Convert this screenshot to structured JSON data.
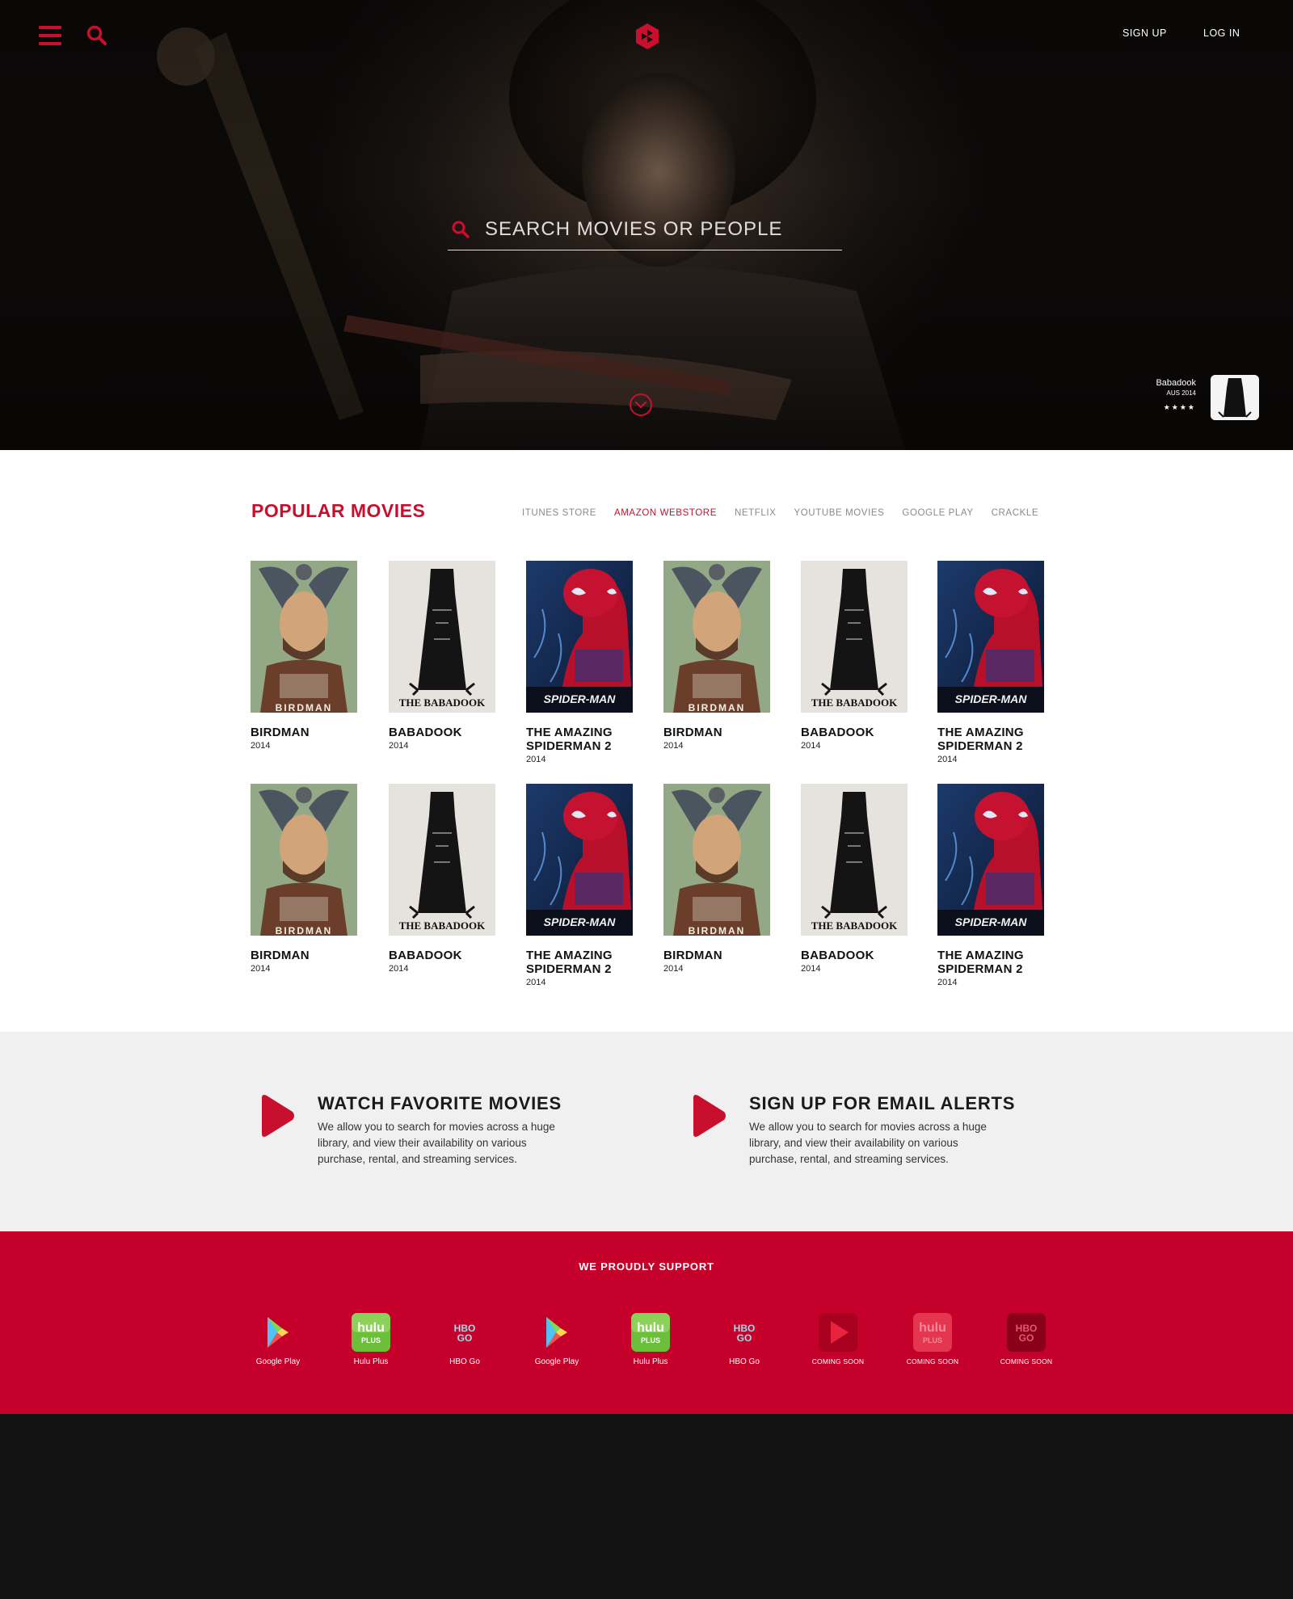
{
  "header": {
    "signup_label": "SIGN UP",
    "login_label": "LOG IN"
  },
  "hero": {
    "search_placeholder": "SEARCH MOVIES OR PEOPLE",
    "featured": {
      "title": "Babadook",
      "subtitle": "AUS 2014",
      "stars": "★★★★"
    }
  },
  "popular": {
    "title": "POPULAR MOVIES",
    "tabs": [
      {
        "label": "ITUNES STORE",
        "active": false
      },
      {
        "label": "AMAZON WEBSTORE",
        "active": true
      },
      {
        "label": "NETFLIX",
        "active": false
      },
      {
        "label": "YOUTUBE MOVIES",
        "active": false
      },
      {
        "label": "GOOGLE PLAY",
        "active": false
      },
      {
        "label": "CRACKLE",
        "active": false
      }
    ],
    "movies": [
      {
        "title": "BIRDMAN",
        "year": "2014",
        "poster": "birdman",
        "poster_text": "BIRDMAN"
      },
      {
        "title": "BABADOOK",
        "year": "2014",
        "poster": "babadook",
        "poster_text": "THE BABADOOK"
      },
      {
        "title": "THE AMAZING SPIDERMAN 2",
        "year": "2014",
        "poster": "spiderman",
        "poster_text": "SPIDER-MAN"
      },
      {
        "title": "BIRDMAN",
        "year": "2014",
        "poster": "birdman",
        "poster_text": "BIRDMAN"
      },
      {
        "title": "BABADOOK",
        "year": "2014",
        "poster": "babadook",
        "poster_text": "THE BABADOOK"
      },
      {
        "title": "THE AMAZING SPIDERMAN 2",
        "year": "2014",
        "poster": "spiderman",
        "poster_text": "SPIDER-MAN"
      },
      {
        "title": "BIRDMAN",
        "year": "2014",
        "poster": "birdman",
        "poster_text": "BIRDMAN"
      },
      {
        "title": "BABADOOK",
        "year": "2014",
        "poster": "babadook",
        "poster_text": "THE BABADOOK"
      },
      {
        "title": "THE AMAZING SPIDERMAN 2",
        "year": "2014",
        "poster": "spiderman",
        "poster_text": "SPIDER-MAN"
      },
      {
        "title": "BIRDMAN",
        "year": "2014",
        "poster": "birdman",
        "poster_text": "BIRDMAN"
      },
      {
        "title": "BABADOOK",
        "year": "2014",
        "poster": "babadook",
        "poster_text": "THE BABADOOK"
      },
      {
        "title": "THE AMAZING SPIDERMAN 2",
        "year": "2014",
        "poster": "spiderman",
        "poster_text": "SPIDER-MAN"
      }
    ]
  },
  "features": [
    {
      "title": "WATCH FAVORITE MOVIES",
      "text": "We allow you to search for movies across a huge library, and view their availability on various purchase, rental, and streaming services."
    },
    {
      "title": "SIGN UP FOR EMAIL ALERTS",
      "text": "We allow you to search for movies across a huge library, and view their availability on various purchase, rental, and streaming services."
    }
  ],
  "support": {
    "title": "WE PROUDLY SUPPORT",
    "providers": [
      {
        "label": "Google Play",
        "logo": "gplay",
        "soon": false
      },
      {
        "label": "Hulu Plus",
        "logo": "hulu",
        "logo_text": "hulu",
        "logo_sub": "PLUS",
        "soon": false
      },
      {
        "label": "HBO Go",
        "logo": "hbo",
        "logo_text": "HBO",
        "logo_sub": "GO",
        "soon": false
      },
      {
        "label": "Google Play",
        "logo": "gplay",
        "soon": false
      },
      {
        "label": "Hulu Plus",
        "logo": "hulu",
        "logo_text": "hulu",
        "logo_sub": "PLUS",
        "soon": false
      },
      {
        "label": "HBO Go",
        "logo": "hbo",
        "logo_text": "HBO",
        "logo_sub": "GO",
        "soon": false
      },
      {
        "label": "COMING SOON",
        "logo": "play-soon",
        "soon": true
      },
      {
        "label": "COMING SOON",
        "logo": "hulu-soon",
        "logo_text": "hulu",
        "logo_sub": "PLUS",
        "soon": true
      },
      {
        "label": "COMING SOON",
        "logo": "hbo-soon",
        "logo_text": "HBO",
        "logo_sub": "GO",
        "soon": true
      }
    ]
  },
  "colors": {
    "brand_red": "#c8102e",
    "support_red": "#c5002a",
    "text_dark": "#111111",
    "tab_grey": "#8a8a8a"
  }
}
